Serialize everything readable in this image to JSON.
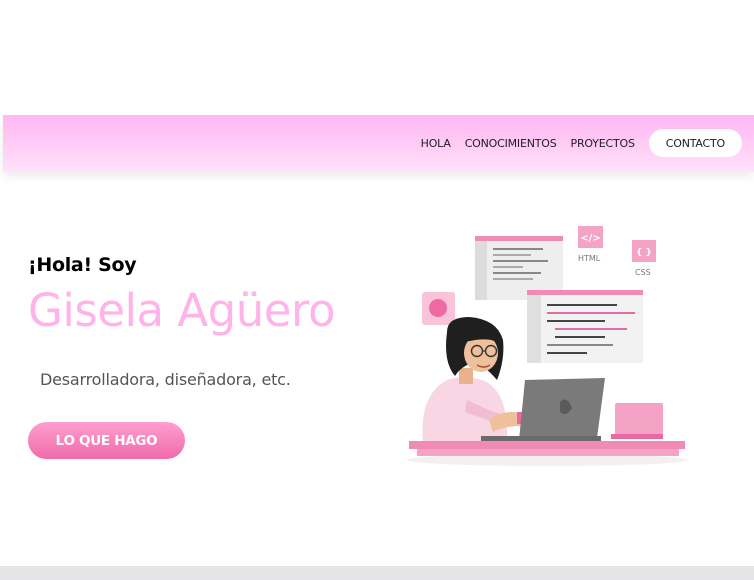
{
  "nav": {
    "links": [
      "HOLA",
      "CONOCIMIENTOS",
      "PROYECTOS"
    ],
    "cta": "CONTACTO"
  },
  "hero": {
    "greeting": "¡Hola! Soy",
    "name": "Gisela Agüero",
    "subtitle": "Desarrolladora, diseñadora, etc.",
    "button": "LO QUE HAGO"
  },
  "illustration": {
    "html_label": "HTML",
    "css_label": "CSS",
    "html_icon": "</>",
    "css_icon": "{ }"
  },
  "colors": {
    "accent_pink": "#ffb3e8",
    "nav_gradient_top": "#ffb7f3",
    "button_pink": "#f06aa8"
  }
}
